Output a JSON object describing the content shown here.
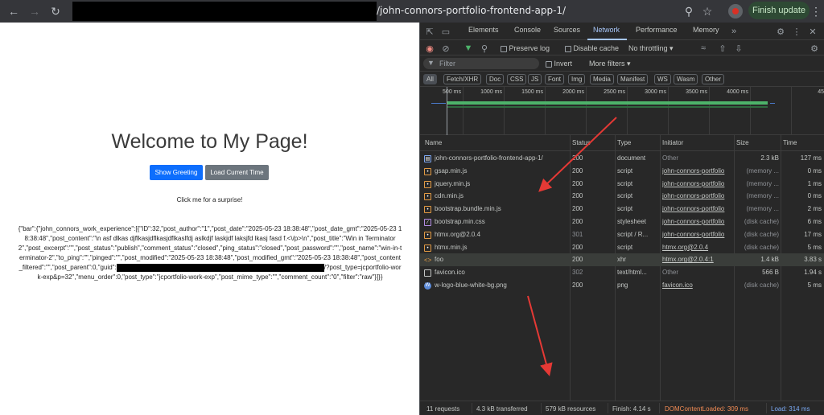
{
  "browser": {
    "url_visible": "/john-connors-portfolio-frontend-app-1/",
    "finish_update_label": "Finish update",
    "icons": {
      "back": "back-arrow-icon",
      "forward": "forward-arrow-icon",
      "reload": "reload-icon",
      "zoom": "zoom-icon",
      "star": "star-icon",
      "menu": "kebab-menu-icon"
    }
  },
  "page": {
    "title": "Welcome to My Page!",
    "greeting_button": "Show Greeting",
    "time_button": "Load Current Time",
    "surprise_text": "Click me for a surprise!",
    "json_part1": "{\"bar\":{\"john_connors_work_experience\":[{\"ID\":32,\"post_author\":\"1\",\"post_date\":\"2025-05-23 18:38:48\",\"post_date_gmt\":\"2025-05-23 18:38:48\",\"post_content\":\"\\n asf dlkas djflkasjdflkasjdflkaslfdj aslkdjf laskjdf laksjfd lkasj fasd f.<\\/p>\\n\",\"post_title\":\"Win in Terminator 2\",\"post_excerpt\":\"\",\"post_status\":\"publish\",\"comment_status\":\"closed\",\"ping_status\":\"closed\",\"post_password\":\"\",\"post_name\":\"win-in-terminator-2\",\"to_ping\":\"\",\"pinged\":\"\",\"post_modified\":\"2025-05-23 18:38:48\",\"post_modified_gmt\":\"2025-05-23 18:38:48\",\"post_content_filtered\":\"\",\"post_parent\":0,\"guid\":",
    "json_part2": "/?post_type=jcportfolio-work-exp&p=32\",\"menu_order\":0,\"post_type\":\"jcportfolio-work-exp\",\"post_mime_type\":\"\",\"comment_count\":\"0\",\"filter\":\"raw\"}]}}"
  },
  "devtools": {
    "tabs": [
      "Elements",
      "Console",
      "Sources",
      "Network",
      "Performance",
      "Memory"
    ],
    "active_tab": "Network",
    "toolbar": {
      "preserve_log": "Preserve log",
      "disable_cache": "Disable cache",
      "throttling": "No throttling"
    },
    "filter": {
      "placeholder": "Filter",
      "invert": "Invert",
      "more_filters": "More filters"
    },
    "type_filters": [
      "All",
      "Fetch/XHR",
      "Doc",
      "CSS",
      "JS",
      "Font",
      "Img",
      "Media",
      "Manifest",
      "WS",
      "Wasm",
      "Other"
    ],
    "timeline_ticks": [
      "500 ms",
      "1000 ms",
      "1500 ms",
      "2000 ms",
      "2500 ms",
      "3000 ms",
      "3500 ms",
      "4000 ms",
      "45"
    ],
    "columns": {
      "name": "Name",
      "status": "Status",
      "type": "Type",
      "initiator": "Initiator",
      "size": "Size",
      "time": "Time"
    },
    "requests": [
      {
        "name": "john-connors-portfolio-frontend-app-1/",
        "status": "200",
        "type": "document",
        "initiator": "Other",
        "size": "2.3 kB",
        "time": "127 ms",
        "icon": "document-icon"
      },
      {
        "name": "gsap.min.js",
        "status": "200",
        "type": "script",
        "initiator": "john-connors-portfolio",
        "size": "(memory ...",
        "time": "0 ms",
        "icon": "script-icon"
      },
      {
        "name": "jquery.min.js",
        "status": "200",
        "type": "script",
        "initiator": "john-connors-portfolio",
        "size": "(memory ...",
        "time": "1 ms",
        "icon": "script-icon"
      },
      {
        "name": "cdn.min.js",
        "status": "200",
        "type": "script",
        "initiator": "john-connors-portfolio",
        "size": "(memory ...",
        "time": "0 ms",
        "icon": "script-icon"
      },
      {
        "name": "bootstrap.bundle.min.js",
        "status": "200",
        "type": "script",
        "initiator": "john-connors-portfolio",
        "size": "(memory ...",
        "time": "2 ms",
        "icon": "script-icon"
      },
      {
        "name": "bootstrap.min.css",
        "status": "200",
        "type": "stylesheet",
        "initiator": "john-connors-portfolio",
        "size": "(disk cache)",
        "time": "6 ms",
        "icon": "stylesheet-icon"
      },
      {
        "name": "htmx.org@2.0.4",
        "status": "301",
        "type": "script / R...",
        "initiator": "john-connors-portfolio",
        "size": "(disk cache)",
        "time": "17 ms",
        "icon": "script-icon"
      },
      {
        "name": "htmx.min.js",
        "status": "200",
        "type": "script",
        "initiator": "htmx.org@2.0.4",
        "size": "(disk cache)",
        "time": "5 ms",
        "icon": "script-icon"
      },
      {
        "name": "foo",
        "status": "200",
        "type": "xhr",
        "initiator": "htmx.org@2.0.4:1",
        "size": "1.4 kB",
        "time": "3.83 s",
        "icon": "xhr-icon"
      },
      {
        "name": "favicon.ico",
        "status": "302",
        "type": "text/html...",
        "initiator": "Other",
        "size": "566 B",
        "time": "1.94 s",
        "icon": "file-icon"
      },
      {
        "name": "w-logo-blue-white-bg.png",
        "status": "200",
        "type": "png",
        "initiator": "favicon.ico",
        "size": "(disk cache)",
        "time": "5 ms",
        "icon": "image-icon"
      }
    ],
    "status": {
      "requests": "11 requests",
      "transferred": "4.3 kB transferred",
      "resources": "579 kB resources",
      "finish": "Finish: 4.14 s",
      "domcontentloaded": "DOMContentLoaded: 309 ms",
      "load": "Load: 314 ms"
    },
    "colors": {
      "active": "#a8c7fa",
      "dcl": "#f28b54",
      "load": "#7cacf8",
      "annotation_arrow": "#e53935"
    }
  }
}
